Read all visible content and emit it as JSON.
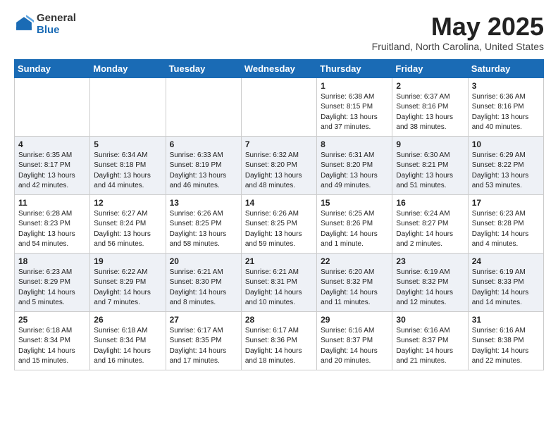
{
  "logo": {
    "general": "General",
    "blue": "Blue"
  },
  "title": "May 2025",
  "location": "Fruitland, North Carolina, United States",
  "days_of_week": [
    "Sunday",
    "Monday",
    "Tuesday",
    "Wednesday",
    "Thursday",
    "Friday",
    "Saturday"
  ],
  "weeks": [
    [
      {
        "day": "",
        "info": ""
      },
      {
        "day": "",
        "info": ""
      },
      {
        "day": "",
        "info": ""
      },
      {
        "day": "",
        "info": ""
      },
      {
        "day": "1",
        "info": "Sunrise: 6:38 AM\nSunset: 8:15 PM\nDaylight: 13 hours\nand 37 minutes."
      },
      {
        "day": "2",
        "info": "Sunrise: 6:37 AM\nSunset: 8:16 PM\nDaylight: 13 hours\nand 38 minutes."
      },
      {
        "day": "3",
        "info": "Sunrise: 6:36 AM\nSunset: 8:16 PM\nDaylight: 13 hours\nand 40 minutes."
      }
    ],
    [
      {
        "day": "4",
        "info": "Sunrise: 6:35 AM\nSunset: 8:17 PM\nDaylight: 13 hours\nand 42 minutes."
      },
      {
        "day": "5",
        "info": "Sunrise: 6:34 AM\nSunset: 8:18 PM\nDaylight: 13 hours\nand 44 minutes."
      },
      {
        "day": "6",
        "info": "Sunrise: 6:33 AM\nSunset: 8:19 PM\nDaylight: 13 hours\nand 46 minutes."
      },
      {
        "day": "7",
        "info": "Sunrise: 6:32 AM\nSunset: 8:20 PM\nDaylight: 13 hours\nand 48 minutes."
      },
      {
        "day": "8",
        "info": "Sunrise: 6:31 AM\nSunset: 8:20 PM\nDaylight: 13 hours\nand 49 minutes."
      },
      {
        "day": "9",
        "info": "Sunrise: 6:30 AM\nSunset: 8:21 PM\nDaylight: 13 hours\nand 51 minutes."
      },
      {
        "day": "10",
        "info": "Sunrise: 6:29 AM\nSunset: 8:22 PM\nDaylight: 13 hours\nand 53 minutes."
      }
    ],
    [
      {
        "day": "11",
        "info": "Sunrise: 6:28 AM\nSunset: 8:23 PM\nDaylight: 13 hours\nand 54 minutes."
      },
      {
        "day": "12",
        "info": "Sunrise: 6:27 AM\nSunset: 8:24 PM\nDaylight: 13 hours\nand 56 minutes."
      },
      {
        "day": "13",
        "info": "Sunrise: 6:26 AM\nSunset: 8:25 PM\nDaylight: 13 hours\nand 58 minutes."
      },
      {
        "day": "14",
        "info": "Sunrise: 6:26 AM\nSunset: 8:25 PM\nDaylight: 13 hours\nand 59 minutes."
      },
      {
        "day": "15",
        "info": "Sunrise: 6:25 AM\nSunset: 8:26 PM\nDaylight: 14 hours\nand 1 minute."
      },
      {
        "day": "16",
        "info": "Sunrise: 6:24 AM\nSunset: 8:27 PM\nDaylight: 14 hours\nand 2 minutes."
      },
      {
        "day": "17",
        "info": "Sunrise: 6:23 AM\nSunset: 8:28 PM\nDaylight: 14 hours\nand 4 minutes."
      }
    ],
    [
      {
        "day": "18",
        "info": "Sunrise: 6:23 AM\nSunset: 8:29 PM\nDaylight: 14 hours\nand 5 minutes."
      },
      {
        "day": "19",
        "info": "Sunrise: 6:22 AM\nSunset: 8:29 PM\nDaylight: 14 hours\nand 7 minutes."
      },
      {
        "day": "20",
        "info": "Sunrise: 6:21 AM\nSunset: 8:30 PM\nDaylight: 14 hours\nand 8 minutes."
      },
      {
        "day": "21",
        "info": "Sunrise: 6:21 AM\nSunset: 8:31 PM\nDaylight: 14 hours\nand 10 minutes."
      },
      {
        "day": "22",
        "info": "Sunrise: 6:20 AM\nSunset: 8:32 PM\nDaylight: 14 hours\nand 11 minutes."
      },
      {
        "day": "23",
        "info": "Sunrise: 6:19 AM\nSunset: 8:32 PM\nDaylight: 14 hours\nand 12 minutes."
      },
      {
        "day": "24",
        "info": "Sunrise: 6:19 AM\nSunset: 8:33 PM\nDaylight: 14 hours\nand 14 minutes."
      }
    ],
    [
      {
        "day": "25",
        "info": "Sunrise: 6:18 AM\nSunset: 8:34 PM\nDaylight: 14 hours\nand 15 minutes."
      },
      {
        "day": "26",
        "info": "Sunrise: 6:18 AM\nSunset: 8:34 PM\nDaylight: 14 hours\nand 16 minutes."
      },
      {
        "day": "27",
        "info": "Sunrise: 6:17 AM\nSunset: 8:35 PM\nDaylight: 14 hours\nand 17 minutes."
      },
      {
        "day": "28",
        "info": "Sunrise: 6:17 AM\nSunset: 8:36 PM\nDaylight: 14 hours\nand 18 minutes."
      },
      {
        "day": "29",
        "info": "Sunrise: 6:16 AM\nSunset: 8:37 PM\nDaylight: 14 hours\nand 20 minutes."
      },
      {
        "day": "30",
        "info": "Sunrise: 6:16 AM\nSunset: 8:37 PM\nDaylight: 14 hours\nand 21 minutes."
      },
      {
        "day": "31",
        "info": "Sunrise: 6:16 AM\nSunset: 8:38 PM\nDaylight: 14 hours\nand 22 minutes."
      }
    ]
  ]
}
